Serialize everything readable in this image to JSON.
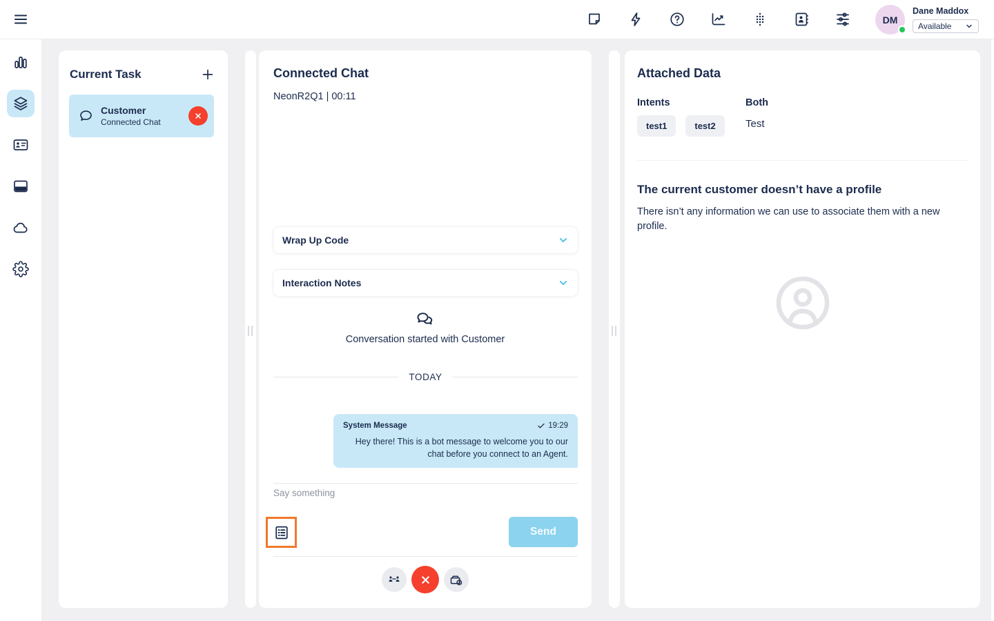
{
  "topbar": {
    "icon_names": [
      "notes-icon",
      "quick-launch-icon",
      "help-icon",
      "reports-icon",
      "dialpad-icon",
      "address-book-icon",
      "preferences-icon"
    ],
    "user": {
      "initials": "DM",
      "name": "Dane Maddox",
      "status": "Available"
    }
  },
  "sidebar": {
    "icon_names": [
      "dashboard-icon",
      "interactions-icon",
      "directory-icon",
      "apps-icon",
      "cloud-icon",
      "settings-icon"
    ],
    "active": "interactions-icon"
  },
  "current_task": {
    "title": "Current Task",
    "task": {
      "name": "Customer",
      "type": "Connected Chat"
    }
  },
  "chat": {
    "title": "Connected Chat",
    "session_info": "NeonR2Q1 | 00:11",
    "wrap_up_label": "Wrap Up Code",
    "interaction_notes_label": "Interaction Notes",
    "conversation_started": "Conversation started with Customer",
    "day_divider": "TODAY",
    "message": {
      "sender": "System Message",
      "time": "19:29",
      "text": "Hey there! This is a bot message to welcome you to our chat before you connect to an Agent."
    },
    "input_placeholder": "Say something",
    "send_label": "Send"
  },
  "attached_data": {
    "title": "Attached Data",
    "intents_label": "Intents",
    "intents": [
      "test1",
      "test2"
    ],
    "both_label": "Both",
    "both_value": "Test",
    "no_profile_title": "The current customer doesn’t have a profile",
    "no_profile_text": "There isn’t any information we can use to associate them with a new profile."
  },
  "colors": {
    "navy": "#1b2b4d",
    "light_blue": "#c9e8f7",
    "send_blue": "#8bd3ef",
    "alert_red": "#f4402d",
    "highlight_orange": "#f0792b",
    "status_green": "#23c65b",
    "avatar_pink": "#ecd7ee"
  }
}
